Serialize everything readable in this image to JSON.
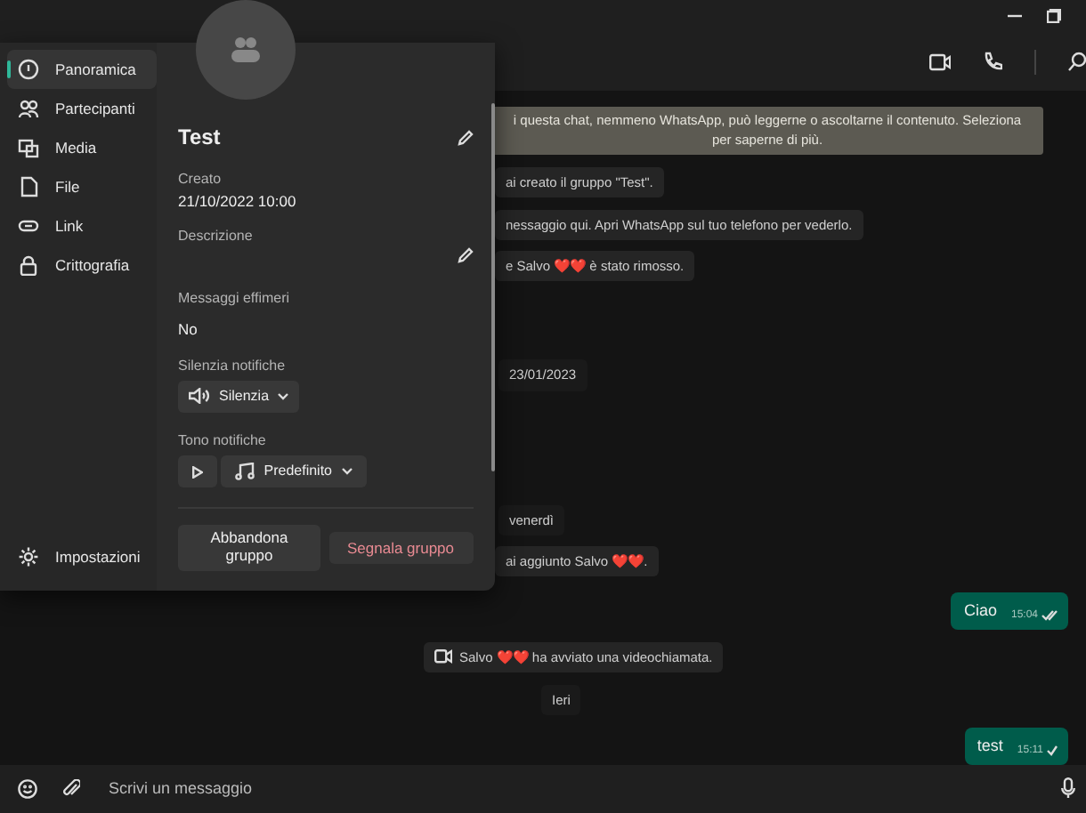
{
  "nav": {
    "items": [
      {
        "label": "Panoramica",
        "selected": true
      },
      {
        "label": "Partecipanti",
        "selected": false
      },
      {
        "label": "Media",
        "selected": false
      },
      {
        "label": "File",
        "selected": false
      },
      {
        "label": "Link",
        "selected": false
      },
      {
        "label": "Crittografia",
        "selected": false
      }
    ],
    "settings": "Impostazioni"
  },
  "details": {
    "name": "Test",
    "created_label": "Creato",
    "created": "21/10/2022 10:00",
    "description_label": "Descrizione",
    "ephemeral_label": "Messaggi effimeri",
    "ephemeral": "No",
    "mute_label": "Silenzia notifiche",
    "mute_button": "Silenzia",
    "tone_label": "Tono notifiche",
    "tone_button": "Predefinito",
    "leave_button": "Abbandona gruppo",
    "report_button": "Segnala gruppo"
  },
  "messages": [
    {
      "kind": "banner",
      "text": "i questa chat, nemmeno WhatsApp, può leggerne o ascoltarne il contenuto. Seleziona per saperne di più."
    },
    {
      "kind": "system",
      "text": "ai creato il gruppo \"Test\"."
    },
    {
      "kind": "system",
      "text": "nessaggio qui. Apri WhatsApp sul tuo telefono per vederlo."
    },
    {
      "kind": "system",
      "text": "e Salvo ❤️❤️ è stato rimosso."
    },
    {
      "kind": "date",
      "text": "23/01/2023"
    },
    {
      "kind": "date",
      "text": "venerdì"
    },
    {
      "kind": "system",
      "text": "ai aggiunto Salvo ❤️❤️."
    },
    {
      "kind": "outgoing",
      "text": "Ciao",
      "time": "15:04",
      "read": true
    },
    {
      "kind": "call",
      "text": "Salvo ❤️❤️ ha avviato una videochiamata."
    },
    {
      "kind": "date",
      "text": "Ieri"
    },
    {
      "kind": "outgoing",
      "text": "test",
      "time": "15:11",
      "read": false
    }
  ],
  "composer": {
    "placeholder": "Scrivi un messaggio"
  }
}
